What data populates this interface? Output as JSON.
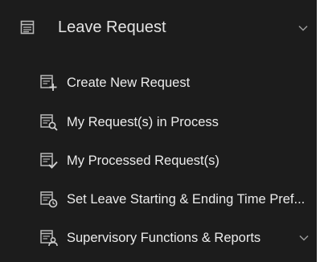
{
  "menu": {
    "header": {
      "label": "Leave Request",
      "icon": "calendar-list-icon",
      "expanded": true
    },
    "items": [
      {
        "label": "Create New Request",
        "icon": "list-add-icon"
      },
      {
        "label": "My Request(s) in Process",
        "icon": "list-search-icon"
      },
      {
        "label": "My Processed Request(s)",
        "icon": "list-check-icon"
      },
      {
        "label": "Set Leave Starting & Ending Time Pref...",
        "icon": "list-clock-icon"
      },
      {
        "label": "Supervisory Functions & Reports",
        "icon": "list-supervisor-icon",
        "has_submenu": true
      }
    ]
  },
  "colors": {
    "panel_background": "#1c1c1c",
    "text": "#e4e4e4",
    "icon": "#b8b8b8",
    "chevron": "#9a9a9a"
  }
}
